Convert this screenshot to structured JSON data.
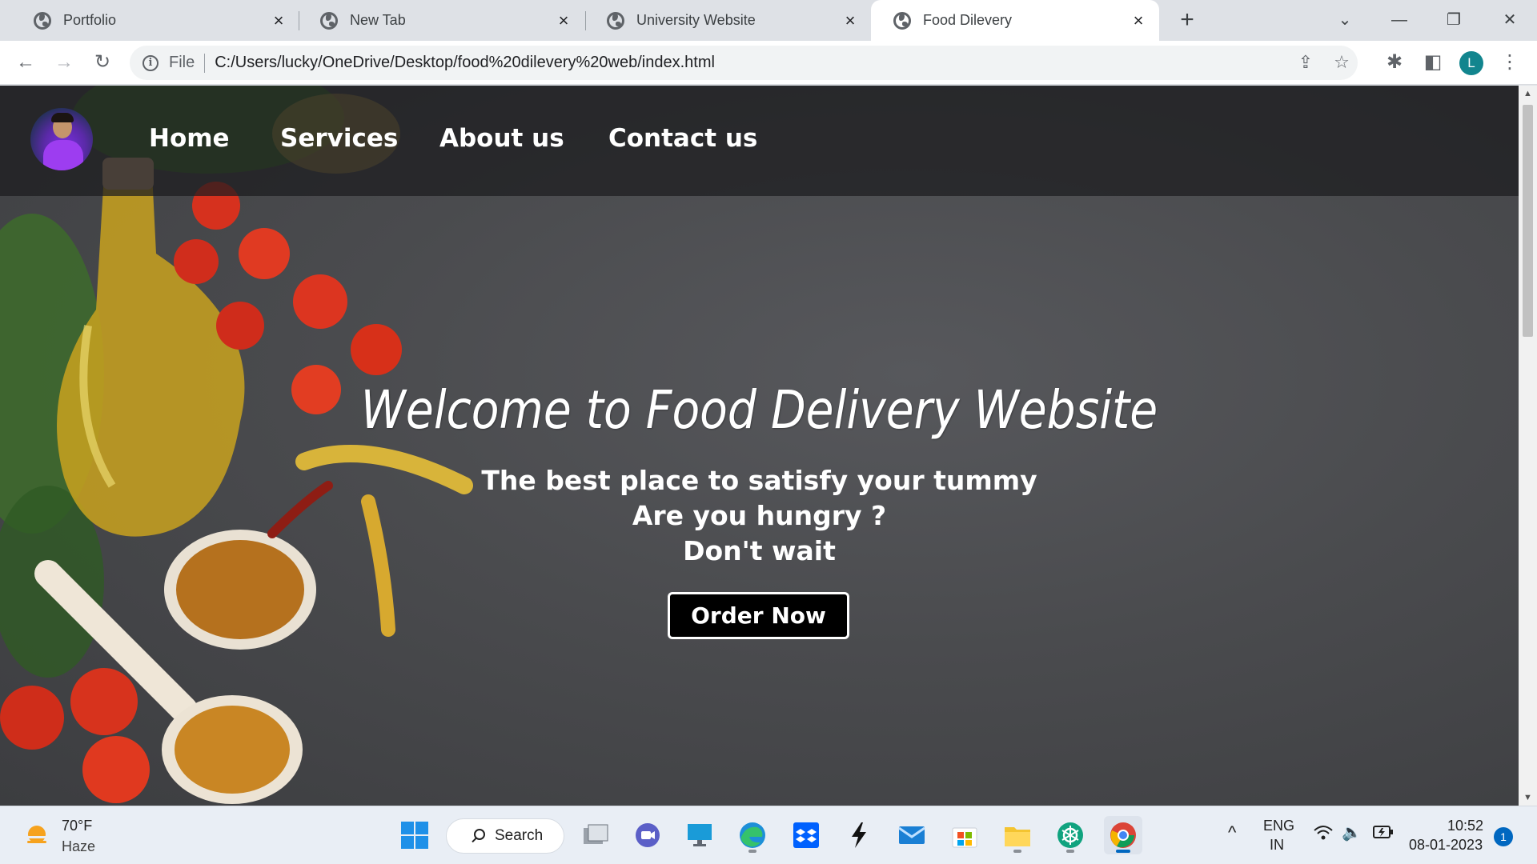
{
  "browser": {
    "tabs": [
      {
        "label": "Portfolio",
        "active": false
      },
      {
        "label": "New Tab",
        "active": false
      },
      {
        "label": "University Website",
        "active": false
      },
      {
        "label": "Food Dilevery",
        "active": true
      }
    ],
    "omnibox": {
      "scheme_label": "File",
      "url": "C:/Users/lucky/OneDrive/Desktop/food%20dilevery%20web/index.html"
    },
    "profile_initial": "L",
    "profile_color": "#12858e"
  },
  "page": {
    "nav": {
      "items": [
        {
          "label": "Home"
        },
        {
          "label": "Services"
        },
        {
          "label": "About us"
        },
        {
          "label": "Contact us"
        }
      ]
    },
    "hero": {
      "title": "Welcome to Food Delivery Website",
      "lines": [
        "The best place to satisfy your tummy",
        "Are you hungry ?",
        "Don't wait"
      ],
      "cta_label": "Order Now"
    }
  },
  "taskbar": {
    "weather": {
      "temp": "70°F",
      "desc": "Haze"
    },
    "search_label": "Search",
    "tray": {
      "lang_top": "ENG",
      "lang_bottom": "IN",
      "time": "10:52",
      "date": "08-01-2023",
      "notifications": "1"
    }
  }
}
